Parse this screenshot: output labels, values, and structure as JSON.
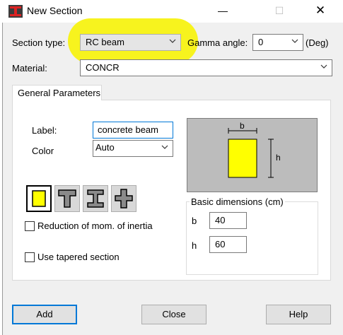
{
  "window": {
    "title": "New Section"
  },
  "colors": {
    "highlight": "#f7f31e",
    "beam_fill": "#ffff00",
    "preview_bg": "#bcbcbc"
  },
  "section_type": {
    "label": "Section type:",
    "value": "RC beam"
  },
  "gamma": {
    "label": "Gamma angle:",
    "value": "0",
    "unit": "(Deg)"
  },
  "material": {
    "label": "Material:",
    "value": "CONCR"
  },
  "tab": {
    "label": "General Parameters"
  },
  "label_field": {
    "label": "Label:",
    "value": "concrete beam"
  },
  "color_field": {
    "label": "Color",
    "value": "Auto"
  },
  "preview": {
    "b": "b",
    "h": "h"
  },
  "shapes": [
    {
      "name": "rectangle"
    },
    {
      "name": "t-section"
    },
    {
      "name": "i-section"
    },
    {
      "name": "cross-section"
    }
  ],
  "reduction": {
    "label": "Reduction of mom. of inertia",
    "checked": false
  },
  "tapered": {
    "label": "Use tapered section",
    "checked": false
  },
  "dimensions": {
    "legend": "Basic dimensions (cm)",
    "b_label": "b",
    "b_value": "40",
    "h_label": "h",
    "h_value": "60"
  },
  "buttons": {
    "add": "Add",
    "close": "Close",
    "help": "Help"
  }
}
